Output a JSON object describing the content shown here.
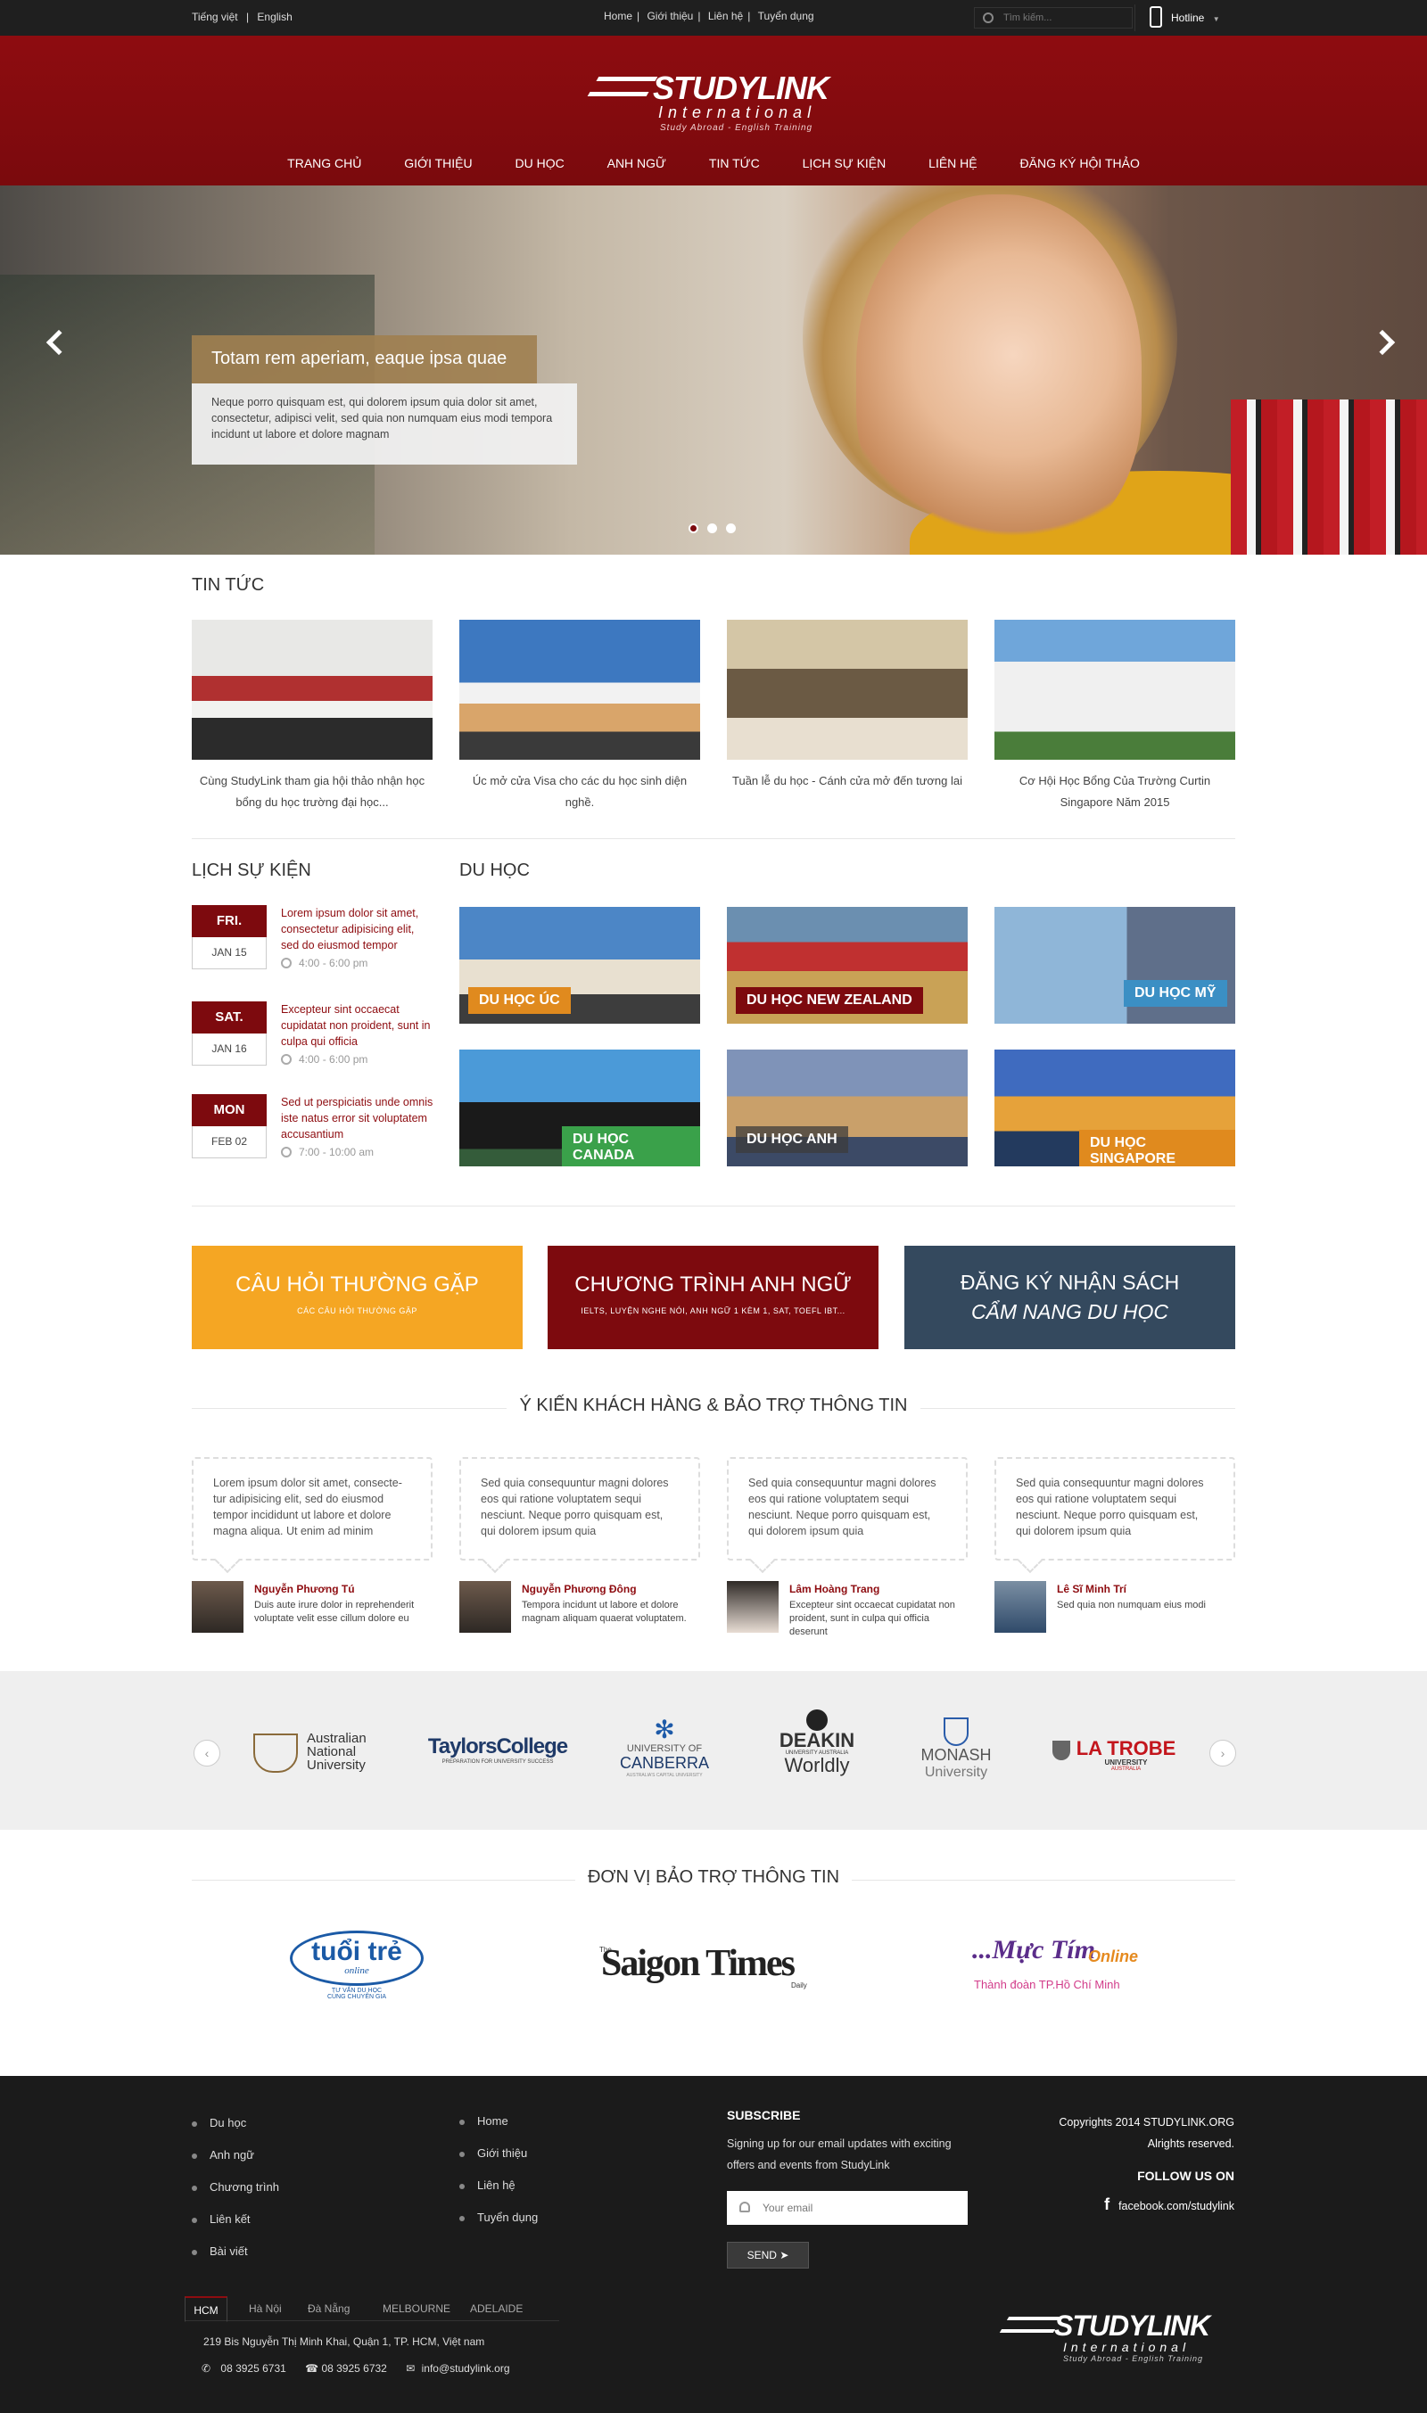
{
  "topbar": {
    "lang_vi": "Tiếng việt",
    "lang_sep": "|",
    "lang_en": "English",
    "links": [
      "Home",
      "Giới thiệu",
      "Liên hệ",
      "Tuyển dụng"
    ],
    "search_placeholder": "Tìm kiếm...",
    "hotline": "Hotline"
  },
  "logo": {
    "name": "STUDYLINK",
    "sub": "International",
    "tagline": "Study Abroad - English Training"
  },
  "nav": [
    "TRANG CHỦ",
    "GIỚI THIỆU",
    "DU HỌC",
    "ANH NGỮ",
    "TIN TỨC",
    "LỊCH SỰ KIỆN",
    "LIÊN HỆ",
    "ĐĂNG KÝ HỘI THẢO"
  ],
  "hero": {
    "title": "Totam rem aperiam, eaque ipsa quae",
    "text": "Neque porro quisquam est, qui dolorem ipsum quia dolor sit amet, consectetur, adipisci velit, sed quia non numquam eius modi tempora incidunt ut labore et dolore magnam",
    "slides": 3,
    "active": 1
  },
  "news": {
    "title": "TIN TỨC",
    "items": [
      "Cùng StudyLink tham gia hội thảo nhận học bổng du học trường đại học...",
      "Úc mở cửa Visa cho các du học sinh diện nghề.",
      "Tuần lễ du học - Cánh cửa mở đến tương lai",
      "Cơ Hội Học Bổng Của Trường Curtin Singapore Năm 2015"
    ]
  },
  "events": {
    "title": "LỊCH SỰ KIỆN",
    "items": [
      {
        "day": "FRI.",
        "date": "JAN 15",
        "text": "Lorem ipsum dolor sit amet, consectetur adipisicing elit, sed do eiusmod tempor",
        "time": "4:00 - 6:00 pm"
      },
      {
        "day": "SAT.",
        "date": "JAN 16",
        "text": "Excepteur sint occaecat cupidatat non proident, sunt in culpa qui officia",
        "time": "4:00 - 6:00 pm"
      },
      {
        "day": "MON",
        "date": "FEB 02",
        "text": "Sed ut perspiciatis unde omnis iste natus error sit voluptatem accusantium",
        "time": "7:00 - 10:00 am"
      }
    ]
  },
  "study": {
    "title": "DU HỌC",
    "tiles": [
      "DU HỌC ÚC",
      "DU HỌC NEW ZEALAND",
      "DU HỌC MỸ",
      "DU HỌC CANADA",
      "DU HỌC ANH",
      "DU HỌC SINGAPORE"
    ]
  },
  "cta": [
    {
      "title": "CÂU HỎI THƯỜNG GẶP",
      "sub": "CÁC CÂU HỎI THƯỜNG GẶP",
      "color": "#f5a623"
    },
    {
      "title": "CHƯƠNG TRÌNH ANH NGỮ",
      "sub": "IELTS, LUYỆN NGHE NÓI, ANH NGỮ 1 KÈM 1, SAT, TOEFL IBT...",
      "color": "#7d0a0e"
    },
    {
      "title": "ĐĂNG KÝ NHẬN SÁCH",
      "title2": "CẨM NANG DU HỌC",
      "color": "#34495e"
    }
  ],
  "testimonials": {
    "title": "Ý KIẾN KHÁCH HÀNG & BẢO TRỢ THÔNG TIN",
    "items": [
      {
        "quote": "Lorem ipsum dolor sit amet, consecte-tur adipisicing elit, sed do eiusmod tempor incididunt ut labore et dolore magna aliqua. Ut enim ad minim",
        "name": "Nguyễn Phương Tú",
        "desc": "Duis aute irure dolor in reprehenderit voluptate velit esse cillum dolore eu"
      },
      {
        "quote": "Sed quia consequuntur magni dolores eos qui ratione voluptatem sequi nesciunt. Neque porro quisquam est, qui dolorem ipsum quia",
        "name": "Nguyễn Phương Đông",
        "desc": "Tempora incidunt ut labore et dolore magnam aliquam quaerat voluptatem."
      },
      {
        "quote": "Sed quia consequuntur magni dolores eos qui ratione voluptatem sequi nesciunt. Neque porro quisquam est, qui dolorem ipsum quia",
        "name": "Lâm Hoàng Trang",
        "desc": "Excepteur sint occaecat cupidatat non proident, sunt in culpa qui officia deserunt"
      },
      {
        "quote": "Sed quia consequuntur magni dolores eos qui ratione voluptatem sequi nesciunt. Neque porro quisquam est, qui dolorem ipsum quia",
        "name": "Lê Sĩ Minh Trí",
        "desc": "Sed quia non numquam eius modi"
      }
    ]
  },
  "partners": [
    {
      "l1": "Australian",
      "l2": "National",
      "l3": "University"
    },
    {
      "l1": "TaylorsCollege",
      "l2": "PREPARATION FOR UNIVERSITY SUCCESS"
    },
    {
      "l1": "UNIVERSITY OF",
      "l2": "CANBERRA",
      "l3": "AUSTRALIA'S CAPITAL UNIVERSITY"
    },
    {
      "l1": "DEAKIN",
      "l2": "UNIVERSITY AUSTRALIA",
      "l3": "Worldly"
    },
    {
      "l1": "MONASH",
      "l2": "University"
    },
    {
      "l1": "LA TROBE",
      "l2": "UNIVERSITY",
      "l3": "AUSTRALIA"
    }
  ],
  "sponsors": {
    "title": "ĐƠN VỊ BẢO TRỢ THÔNG TIN",
    "items": [
      {
        "name": "tuổi trẻ",
        "sub": "online",
        "note1": "TƯ VẤN DU HỌC",
        "note2": "CÙNG CHUYÊN GIA"
      },
      {
        "name": "Saigon Times",
        "pre": "The",
        "post": "Daily"
      },
      {
        "name": "...Mực Tím",
        "post": "Online",
        "sub": "Thành đoàn TP.Hồ Chí Minh"
      }
    ]
  },
  "footer": {
    "col1": [
      "Du học",
      "Anh ngữ",
      "Chương trình",
      "Liên kết",
      "Bài viết"
    ],
    "col2": [
      "Home",
      "Giới thiệu",
      "Liên hệ",
      "Tuyển dụng"
    ],
    "subscribe_title": "SUBSCRIBE",
    "subscribe_text": "Signing up for our email updates with exciting offers and events from StudyLink",
    "email_placeholder": "Your email",
    "send": "SEND",
    "copyright": "Copyrights 2014 STUDYLINK.ORG",
    "rights": "Alrights reserved.",
    "follow": "FOLLOW US ON",
    "facebook": "facebook.com/studylink",
    "tabs": [
      "HCM",
      "Hà Nội",
      "Đà Nẵng",
      "MELBOURNE",
      "ADELAIDE"
    ],
    "address": "219 Bis Nguyễn Thị Minh Khai, Quận 1, TP. HCM, Việt nam",
    "phone1": "08 3925 6731",
    "phone2": "08 3925 6732",
    "email": "info@studylink.org"
  }
}
